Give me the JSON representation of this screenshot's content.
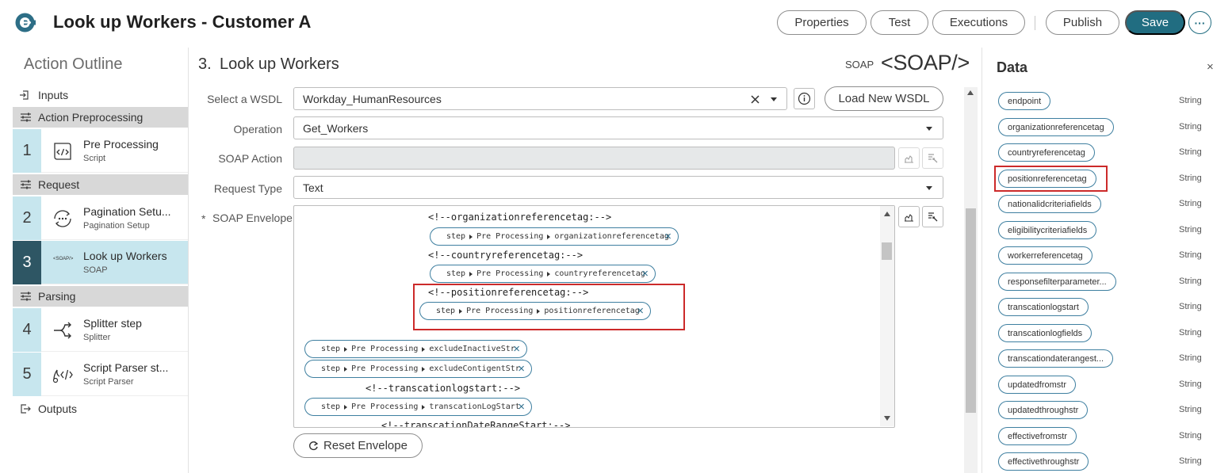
{
  "header": {
    "title": "Look up Workers - Customer A",
    "buttons": {
      "properties": "Properties",
      "test": "Test",
      "executions": "Executions",
      "publish": "Publish",
      "save": "Save"
    }
  },
  "outline": {
    "title": "Action Outline",
    "inputs": "Inputs",
    "outputs": "Outputs",
    "sections": {
      "preprocessing": "Action Preprocessing",
      "request": "Request",
      "parsing": "Parsing"
    },
    "steps": [
      {
        "num": "1",
        "name": "Pre Processing",
        "type": "Script"
      },
      {
        "num": "2",
        "name": "Pagination Setu...",
        "type": "Pagination Setup"
      },
      {
        "num": "3",
        "name": "Look up Workers",
        "type": "SOAP",
        "icon_text": "<SOAP/>"
      },
      {
        "num": "4",
        "name": "Splitter step",
        "type": "Splitter"
      },
      {
        "num": "5",
        "name": "Script Parser st...",
        "type": "Script Parser"
      }
    ]
  },
  "main": {
    "step_num": "3.",
    "title": "Look up Workers",
    "soap_label": "SOAP",
    "soap_logo": "<SOAP/>",
    "labels": {
      "wsdl": "Select a WSDL",
      "operation": "Operation",
      "soap_action": "SOAP Action",
      "request_type": "Request Type",
      "envelope": "SOAP Envelope",
      "required_mark": "*"
    },
    "wsdl_value": "Workday_HumanResources",
    "operation_value": "Get_Workers",
    "soap_action_value": "",
    "request_type_value": "Text",
    "load_wsdl": "Load New WSDL",
    "reset_envelope": "Reset Envelope"
  },
  "envelope": {
    "comments": {
      "org": "<!--organizationreferencetag:-->",
      "country": "<!--countryreferencetag:-->",
      "position": "<!--positionreferencetag:-->",
      "logstart": "<!--transcationlogstart:-->",
      "daterange": "<!--transcationDateRangeStart:-->"
    },
    "chip_step": "step",
    "chip_source": "Pre Processing",
    "chips": {
      "org": "organizationreferencetag",
      "country": "countryreferencetag",
      "position": "positionreferencetag",
      "inactive": "excludeInactiveStr",
      "contigent": "excludeContigentStr",
      "logstart": "transcationLogStart"
    }
  },
  "data_panel": {
    "title": "Data",
    "close": "×",
    "type_label": "String",
    "items": [
      "endpoint",
      "organizationreferencetag",
      "countryreferencetag",
      "positionreferencetag",
      "nationalidcriteriafields",
      "eligibilitycriteriafields",
      "workerreferencetag",
      "responsefilterparameter...",
      "transcationlogstart",
      "transcationlogfields",
      "transcationdaterangest...",
      "updatedfromstr",
      "updatedthroughstr",
      "effectivefromstr",
      "effectivethroughstr"
    ]
  },
  "colors": {
    "accent": "#216d81",
    "highlight": "#cc2a2a",
    "active_step": "#2e5664",
    "step_tint": "#c7e6ee"
  }
}
